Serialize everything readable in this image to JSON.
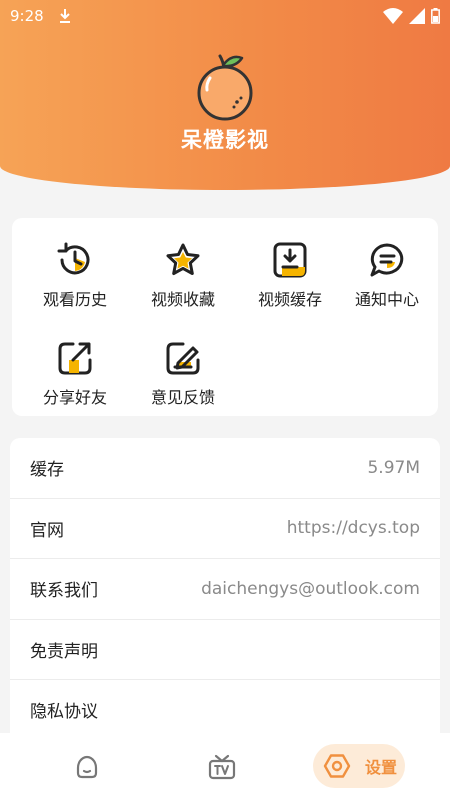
{
  "status_bar": {
    "time": "9:28",
    "icons": [
      "download-icon",
      "wifi-icon",
      "signal-icon",
      "battery-icon"
    ]
  },
  "app": {
    "title": "呆橙影视",
    "logo_icon": "orange-fruit-icon",
    "accent_color": "#f28a47"
  },
  "grid": [
    {
      "label": "观看历史",
      "icon": "history-icon"
    },
    {
      "label": "视频收藏",
      "icon": "star-icon"
    },
    {
      "label": "视频缓存",
      "icon": "download-box-icon"
    },
    {
      "label": "通知中心",
      "icon": "message-icon"
    },
    {
      "label": "分享好友",
      "icon": "share-icon"
    },
    {
      "label": "意见反馈",
      "icon": "feedback-icon"
    }
  ],
  "list": [
    {
      "label": "缓存",
      "value": "5.97M"
    },
    {
      "label": "官网",
      "value": "https://dcys.top"
    },
    {
      "label": "联系我们",
      "value": "daichengys@outlook.com"
    },
    {
      "label": "免责声明",
      "value": ""
    },
    {
      "label": "隐私协议",
      "value": ""
    }
  ],
  "bottom_nav": {
    "items": [
      {
        "icon": "home-icon"
      },
      {
        "icon": "tv-icon"
      },
      {
        "icon": "settings-icon",
        "label": "设置",
        "active": true
      }
    ]
  }
}
